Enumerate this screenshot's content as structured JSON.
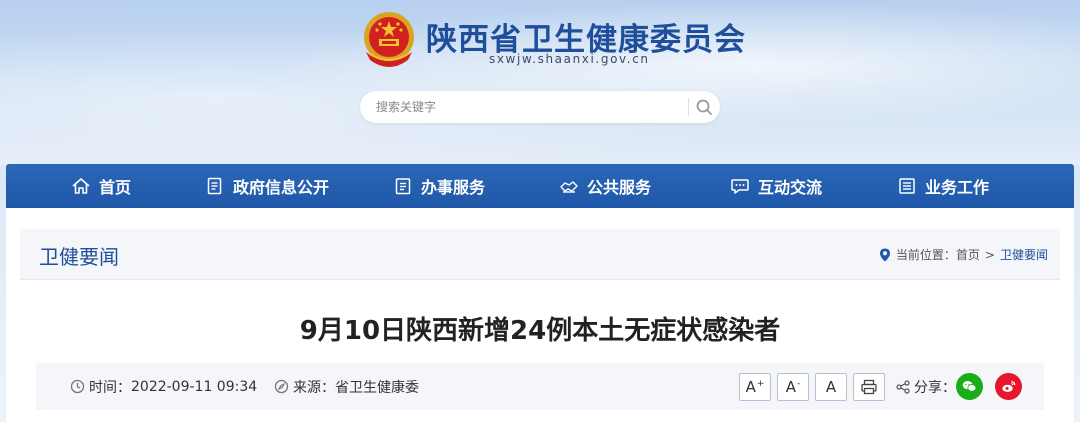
{
  "header": {
    "site_title": "陕西省卫生健康委员会",
    "domain": "sxwjw.shaanxi.gov.cn",
    "emblem_icon": "national-emblem-icon"
  },
  "search": {
    "placeholder": "搜索关键字",
    "value": "",
    "icon": "search-icon"
  },
  "nav": {
    "items": [
      {
        "label": "首页",
        "icon": "home-icon"
      },
      {
        "label": "政府信息公开",
        "icon": "document-list-icon"
      },
      {
        "label": "办事服务",
        "icon": "clipboard-icon"
      },
      {
        "label": "公共服务",
        "icon": "handshake-icon"
      },
      {
        "label": "互动交流",
        "icon": "chat-icon"
      },
      {
        "label": "业务工作",
        "icon": "briefcase-icon"
      }
    ]
  },
  "section": {
    "title": "卫健要闻",
    "breadcrumb_prefix": "当前位置：",
    "breadcrumb": [
      "首页",
      "卫健要闻"
    ],
    "breadcrumb_separator": ">"
  },
  "article": {
    "title": "9月10日陕西新增24例本土无症状感染者",
    "time_label": "时间：",
    "time_value": "2022-09-11 09:34",
    "source_label": "来源：",
    "source_value": "省卫生健康委",
    "font_buttons": [
      "A",
      "A",
      "A"
    ],
    "font_button_marks": [
      "+",
      "-",
      ""
    ],
    "share_label": "分享："
  },
  "colors": {
    "brand_blue": "#1f58a8",
    "title_blue": "#1f4f9a",
    "wechat_green": "#1aad19",
    "weibo_red": "#e6162d"
  }
}
